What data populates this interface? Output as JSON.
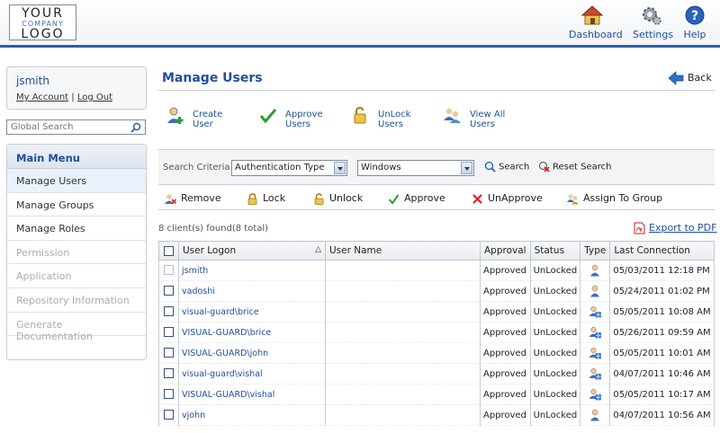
{
  "header": {
    "logo": {
      "line1": "YOUR",
      "line2": "COMPANY",
      "line3": "LOGO"
    },
    "nav": [
      {
        "label": "Dashboard",
        "icon": "house-icon"
      },
      {
        "label": "Settings",
        "icon": "gear-icon"
      },
      {
        "label": "Help",
        "icon": "help-icon"
      }
    ]
  },
  "sidebar": {
    "username": "jsmith",
    "my_account": "My Account",
    "separator": "|",
    "log_out": "Log Out",
    "search_placeholder": "Global Search",
    "menu_title": "Main Menu",
    "items": [
      {
        "label": "Manage Users",
        "state": "active"
      },
      {
        "label": "Manage Groups",
        "state": "enabled"
      },
      {
        "label": "Manage Roles",
        "state": "enabled"
      },
      {
        "label": "Permission",
        "state": "disabled"
      },
      {
        "label": "Application",
        "state": "disabled"
      },
      {
        "label": "Repository Information",
        "state": "disabled"
      },
      {
        "label": "Generate Documentation",
        "state": "disabled"
      }
    ]
  },
  "main": {
    "title": "Manage Users",
    "back_label": "Back",
    "actions": [
      {
        "line1": "Create",
        "line2": "User",
        "icon": "create-user-icon"
      },
      {
        "line1": "Approve",
        "line2": "Users",
        "icon": "approve-check-icon"
      },
      {
        "line1": "UnLock",
        "line2": "Users",
        "icon": "unlock-icon"
      },
      {
        "line1": "View All",
        "line2": "Users",
        "icon": "view-users-icon"
      }
    ],
    "criteria": {
      "label": "Search Criteria",
      "field": "Authentication Type",
      "value": "Windows",
      "search_label": "Search",
      "reset_label": "Reset Search"
    },
    "toolbar": {
      "remove": "Remove",
      "lock": "Lock",
      "unlock": "Unlock",
      "approve": "Approve",
      "unapprove": "UnApprove",
      "assign": "Assign To Group"
    },
    "found_text": "8 client(s) found(8 total)",
    "export_label": "Export to PDF",
    "columns": {
      "logon": "User Logon",
      "name": "User Name",
      "approval": "Approval",
      "status": "Status",
      "type": "Type",
      "last": "Last Connection"
    },
    "rows": [
      {
        "logon": "jsmith",
        "name": "",
        "approval": "Approved",
        "status": "UnLocked",
        "type": "user-icon",
        "last": "05/03/2011 12:18 PM",
        "checkbox_disabled": true
      },
      {
        "logon": "vadoshi",
        "name": "",
        "approval": "Approved",
        "status": "UnLocked",
        "type": "user-icon",
        "last": "05/24/2011 01:02 PM"
      },
      {
        "logon": "visual-guard\\brice",
        "name": "",
        "approval": "Approved",
        "status": "UnLocked",
        "type": "windows-user-icon",
        "last": "05/05/2011 10:08 AM"
      },
      {
        "logon": "VISUAL-GUARD\\brice",
        "name": "",
        "approval": "Approved",
        "status": "UnLocked",
        "type": "windows-user-icon",
        "last": "05/26/2011 09:59 AM"
      },
      {
        "logon": "VISUAL-GUARD\\john",
        "name": "",
        "approval": "Approved",
        "status": "UnLocked",
        "type": "windows-user-icon",
        "last": "05/05/2011 10:01 AM"
      },
      {
        "logon": "visual-guard\\vishal",
        "name": "",
        "approval": "Approved",
        "status": "UnLocked",
        "type": "windows-user-icon",
        "last": "04/07/2011 10:46 AM"
      },
      {
        "logon": "VISUAL-GUARD\\vishal",
        "name": "",
        "approval": "Approved",
        "status": "UnLocked",
        "type": "windows-user-icon",
        "last": "05/05/2011 10:17 AM"
      },
      {
        "logon": "vjohn",
        "name": "",
        "approval": "Approved",
        "status": "UnLocked",
        "type": "user-icon",
        "last": "04/07/2011 10:56 AM"
      }
    ]
  },
  "colors": {
    "brand_blue": "#1f4e9c",
    "header_rule": "#2b5fa8"
  }
}
